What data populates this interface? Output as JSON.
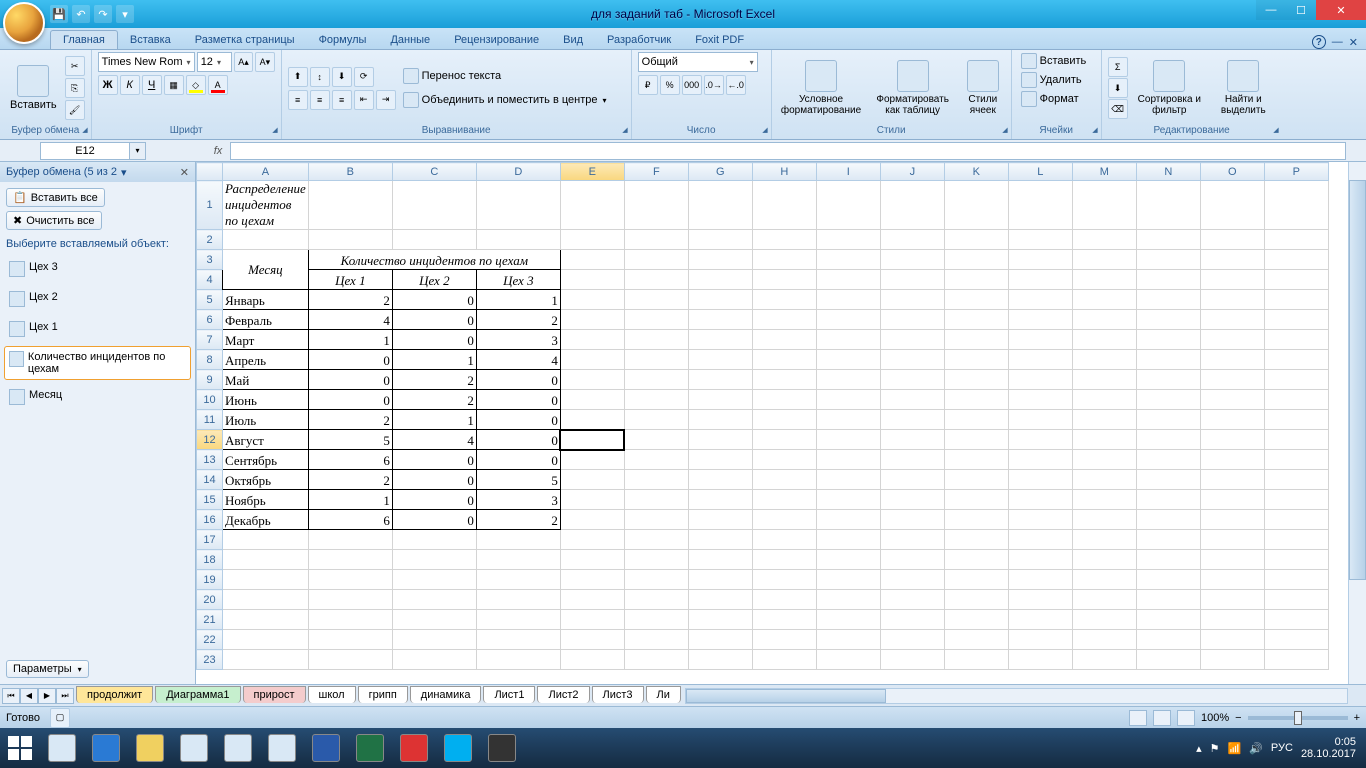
{
  "title": "для заданий таб - Microsoft Excel",
  "tabs": [
    "Главная",
    "Вставка",
    "Разметка страницы",
    "Формулы",
    "Данные",
    "Рецензирование",
    "Вид",
    "Разработчик",
    "Foxit PDF"
  ],
  "activeTab": 0,
  "ribbon": {
    "clipboard": {
      "paste": "Вставить",
      "label": "Буфер обмена"
    },
    "font": {
      "name": "Times New Rom",
      "size": "12",
      "label": "Шрифт",
      "bold": "Ж",
      "italic": "К",
      "underline": "Ч"
    },
    "alignment": {
      "wrap": "Перенос текста",
      "merge": "Объединить и поместить в центре",
      "label": "Выравнивание"
    },
    "number": {
      "format": "Общий",
      "label": "Число"
    },
    "styles": {
      "cond": "Условное форматирование",
      "table": "Форматировать как таблицу",
      "cell": "Стили ячеек",
      "label": "Стили"
    },
    "cells": {
      "insert": "Вставить",
      "delete": "Удалить",
      "format": "Формат",
      "label": "Ячейки"
    },
    "editing": {
      "sort": "Сортировка и фильтр",
      "find": "Найти и выделить",
      "label": "Редактирование"
    }
  },
  "nameBox": "E12",
  "formula": "",
  "taskpane": {
    "title": "Буфер обмена (5 из 2",
    "pasteAll": "Вставить все",
    "clearAll": "Очистить все",
    "prompt": "Выберите вставляемый объект:",
    "items": [
      "Цех 3",
      "Цех 2",
      "Цех 1",
      "Количество инцидентов по цехам",
      "Месяц"
    ],
    "selectedItem": 3,
    "options": "Параметры"
  },
  "columns": [
    "A",
    "B",
    "C",
    "D",
    "E",
    "F",
    "G",
    "H",
    "I",
    "J",
    "K",
    "L",
    "M",
    "N",
    "O",
    "P"
  ],
  "colWidthsPx": [
    70,
    84,
    84,
    84,
    64,
    64,
    64,
    64,
    64,
    64,
    64,
    64,
    64,
    64,
    64,
    64
  ],
  "activeColIndex": 4,
  "activeRowNum": 12,
  "sheet": {
    "title": "Распределение инцидентов по цехам",
    "header1": "Месяц",
    "header2": "Количество инцидентов по цехам",
    "subheaders": [
      "Цех 1",
      "Цех 2",
      "Цех 3"
    ],
    "rows": [
      {
        "m": "Январь",
        "v": [
          2,
          0,
          1
        ]
      },
      {
        "m": "Февраль",
        "v": [
          4,
          0,
          2
        ]
      },
      {
        "m": "Март",
        "v": [
          1,
          0,
          3
        ]
      },
      {
        "m": "Апрель",
        "v": [
          0,
          1,
          4
        ]
      },
      {
        "m": "Май",
        "v": [
          0,
          2,
          0
        ]
      },
      {
        "m": "Июнь",
        "v": [
          0,
          2,
          0
        ]
      },
      {
        "m": "Июль",
        "v": [
          2,
          1,
          0
        ]
      },
      {
        "m": "Август",
        "v": [
          5,
          4,
          0
        ]
      },
      {
        "m": "Сентябрь",
        "v": [
          6,
          0,
          0
        ]
      },
      {
        "m": "Октябрь",
        "v": [
          2,
          0,
          5
        ]
      },
      {
        "m": "Ноябрь",
        "v": [
          1,
          0,
          3
        ]
      },
      {
        "m": "Декабрь",
        "v": [
          6,
          0,
          2
        ]
      }
    ]
  },
  "sheetTabs": [
    "продолжит",
    "Диаграмма1",
    "прирост",
    "школ",
    "грипп",
    "динамика",
    "Лист1",
    "Лист2",
    "Лист3",
    "Ли"
  ],
  "status": {
    "ready": "Готово",
    "zoom": "100%"
  },
  "tray": {
    "lang": "РУС",
    "time": "0:05",
    "date": "28.10.2017"
  }
}
